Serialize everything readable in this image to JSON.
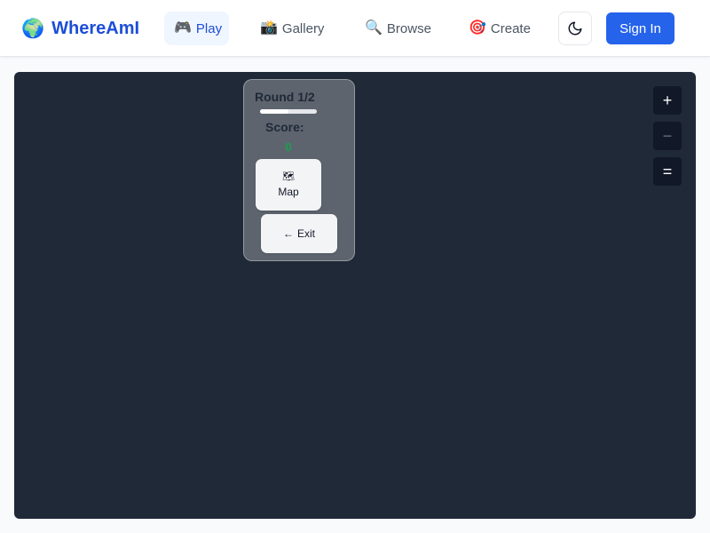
{
  "brand": {
    "icon": "🌍",
    "name": "WhereAmI"
  },
  "nav": {
    "tabs": [
      {
        "icon": "🎮",
        "label": "Play",
        "active": true
      },
      {
        "icon": "📸",
        "label": "Gallery",
        "active": false
      },
      {
        "icon": "🔍",
        "label": "Browse",
        "active": false
      },
      {
        "icon": "🎯",
        "label": "Create",
        "active": false
      }
    ]
  },
  "header": {
    "theme_icon": "moon-icon",
    "signin_label": "Sign In"
  },
  "game": {
    "round_label": "Round 1/2",
    "round_progress": 0.5,
    "score_label": "Score:",
    "score_value": "0",
    "map_button": {
      "icon": "🗺",
      "label": "Map"
    },
    "exit_button": {
      "icon": "←",
      "label": "Exit"
    },
    "controls": {
      "zoom_in": "+",
      "zoom_out": "−",
      "layers": "="
    }
  },
  "colors": {
    "accent": "#2563eb",
    "brand": "#1d4ed8",
    "map_background": "#1f2937",
    "score": "#16a34a"
  }
}
